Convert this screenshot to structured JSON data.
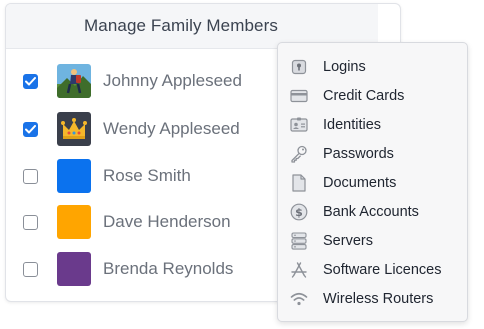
{
  "panel": {
    "title": "Manage Family Members"
  },
  "members": [
    {
      "name": "Johnny Appleseed",
      "checked": true,
      "avatar": "hiker-avatar"
    },
    {
      "name": "Wendy Appleseed",
      "checked": true,
      "avatar": "crown-avatar"
    },
    {
      "name": "Rose Smith",
      "checked": false,
      "avatar": "blue-avatar",
      "color": "#0b72ee"
    },
    {
      "name": "Dave Henderson",
      "checked": false,
      "avatar": "orange-avatar",
      "color": "#ffa500"
    },
    {
      "name": "Brenda Reynolds",
      "checked": false,
      "avatar": "purple-avatar",
      "color": "#6a3a8c"
    }
  ],
  "menu": {
    "items": [
      {
        "label": "Logins",
        "icon": "login-key-icon"
      },
      {
        "label": "Credit Cards",
        "icon": "credit-card-icon"
      },
      {
        "label": "Identities",
        "icon": "identity-card-icon"
      },
      {
        "label": "Passwords",
        "icon": "key-icon"
      },
      {
        "label": "Documents",
        "icon": "document-icon"
      },
      {
        "label": "Bank Accounts",
        "icon": "dollar-coin-icon"
      },
      {
        "label": "Servers",
        "icon": "server-icon"
      },
      {
        "label": "Software Licences",
        "icon": "app-store-icon"
      },
      {
        "label": "Wireless Routers",
        "icon": "wifi-icon"
      }
    ]
  },
  "colors": {
    "accent": "#1a73e8",
    "icon": "#8e9299"
  }
}
